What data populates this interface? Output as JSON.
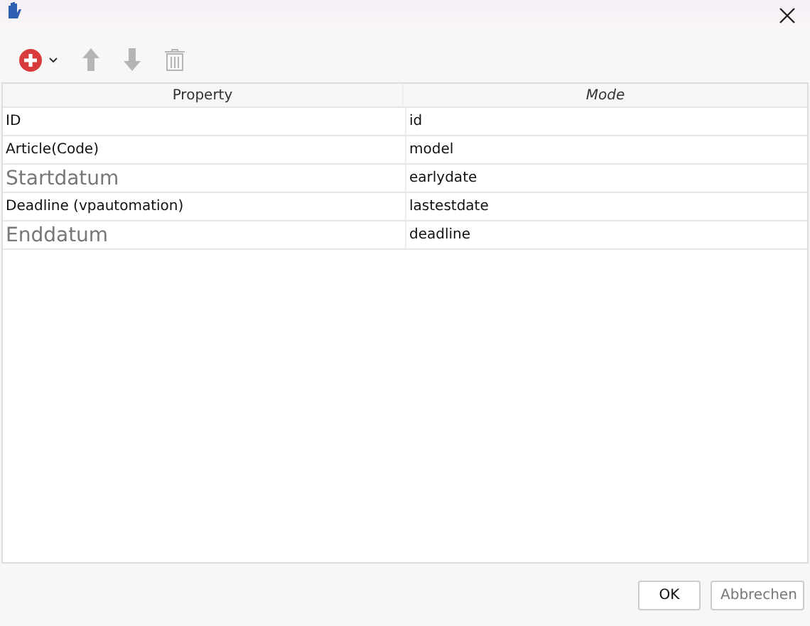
{
  "table": {
    "columns": [
      "Property",
      "Mode"
    ],
    "rows": [
      {
        "property": "ID",
        "mode": "id",
        "kind": "normal"
      },
      {
        "property": "Article(Code)",
        "mode": "model",
        "kind": "normal"
      },
      {
        "property": "Startdatum",
        "mode": "earlydate",
        "kind": "large"
      },
      {
        "property": "Deadline (vpautomation)",
        "mode": "lastestdate",
        "kind": "normal"
      },
      {
        "property": "Enddatum",
        "mode": "deadline",
        "kind": "large"
      }
    ]
  },
  "buttons": [
    "OK",
    "Abbrechen"
  ]
}
